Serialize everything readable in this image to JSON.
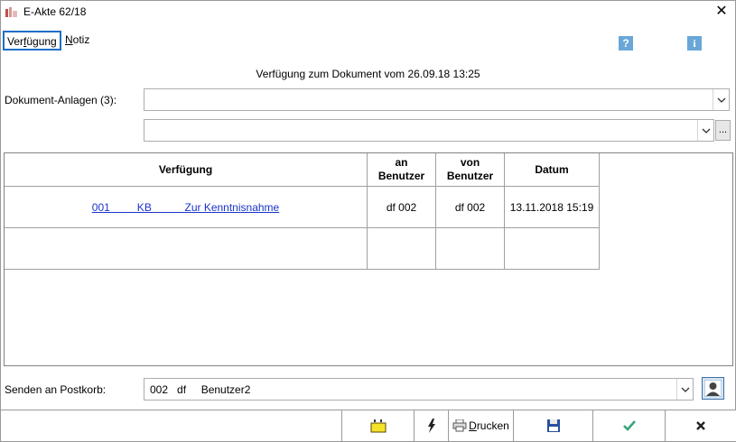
{
  "window": {
    "title": "E-Akte 62/18",
    "close_label": "✕"
  },
  "menu": {
    "tabs": [
      {
        "label_pre": "Ver",
        "label_ul": "f",
        "label_post": "ügung"
      },
      {
        "label_pre": "",
        "label_ul": "N",
        "label_post": "otiz"
      }
    ],
    "help_label": "?",
    "info_label": "i"
  },
  "heading": "Verfügung zum Dokument vom 26.09.18 13:25",
  "attachments": {
    "label": "Dokument-Anlagen (3):",
    "value": "",
    "second_value": "",
    "ellipsis": "..."
  },
  "table": {
    "headers": [
      "Verfügung",
      "an\nBenutzer",
      "von\nBenutzer",
      "Datum"
    ],
    "rows": [
      {
        "verfuegung": "001         KB           Zur Kenntnisnahme",
        "an": "df 002",
        "von": "df 002",
        "datum": "13.11.2018 15:19"
      },
      {
        "verfuegung": "",
        "an": "",
        "von": "",
        "datum": ""
      }
    ]
  },
  "postkorb": {
    "label": "Senden an Postkorb:",
    "value": "002   df     Benutzer2"
  },
  "toolbar": {
    "print_label_ul": "D",
    "print_label_rest": "rucken"
  },
  "colors": {
    "accent": "#1e6fc9",
    "link": "#1a33cc",
    "check": "#3aa37a"
  }
}
